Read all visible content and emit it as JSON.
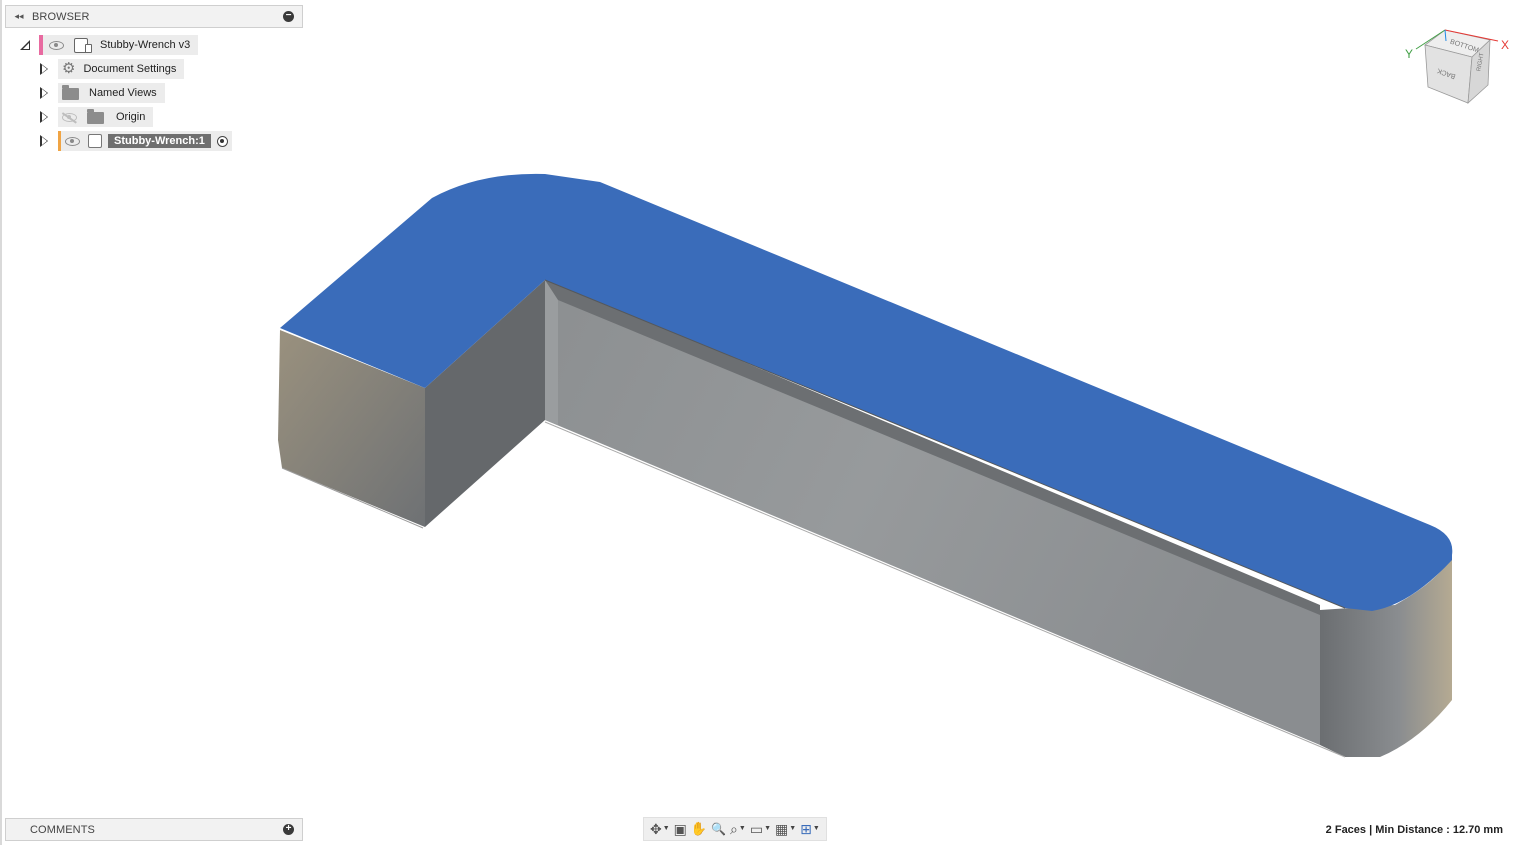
{
  "browser": {
    "title": "BROWSER",
    "collapse_glyph": "◂◂",
    "minimize_glyph": "−",
    "root": {
      "label": "Stubby-Wrench v3",
      "tab_color": "#e86aa0"
    },
    "items": [
      {
        "label": "Document Settings",
        "icon": "gear-icon"
      },
      {
        "label": "Named Views",
        "icon": "folder-icon"
      },
      {
        "label": "Origin",
        "icon": "folder-icon"
      },
      {
        "label": "Stubby-Wrench:1",
        "icon": "component-icon",
        "tab_color": "#f0a444"
      }
    ]
  },
  "comments": {
    "title": "COMMENTS",
    "add_glyph": "+"
  },
  "viewcube": {
    "faces": [
      "BOTTOM",
      "BACK",
      "RIGHT"
    ],
    "axis_x": "X",
    "axis_y": "Y",
    "x_color": "#e53935",
    "y_color": "#43a047",
    "z_color": "#1e88e5"
  },
  "toolbar": {
    "buttons": [
      {
        "name": "orbit",
        "glyph": "✥"
      },
      {
        "name": "look-at",
        "glyph": "▣"
      },
      {
        "name": "pan",
        "glyph": "✋"
      },
      {
        "name": "zoom",
        "glyph": "🔍"
      },
      {
        "name": "fit",
        "glyph": "⌕"
      },
      {
        "name": "display-settings",
        "glyph": "▭"
      },
      {
        "name": "grid-snaps",
        "glyph": "▦"
      },
      {
        "name": "viewports",
        "glyph": "⊞"
      }
    ]
  },
  "status": {
    "text": "2 Faces | Min Distance : 12.70 mm"
  },
  "colors": {
    "top_face": "#3a6cba",
    "side_face": "#8e9193",
    "side_dark": "#6a6d70",
    "edge_tan": "#b7ab93"
  }
}
